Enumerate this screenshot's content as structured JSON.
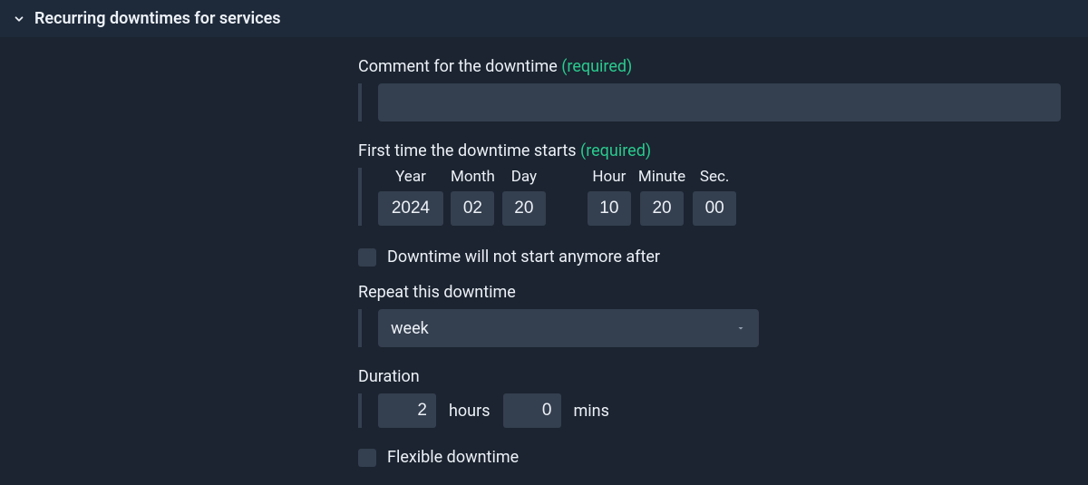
{
  "header": {
    "title": "Recurring downtimes for services"
  },
  "comment": {
    "label": "Comment for the downtime",
    "required": "(required)"
  },
  "starttime": {
    "label": "First time the downtime starts",
    "required": "(required)",
    "heads": {
      "year": "Year",
      "month": "Month",
      "day": "Day",
      "hour": "Hour",
      "minute": "Minute",
      "sec": "Sec."
    },
    "values": {
      "year": "2024",
      "month": "02",
      "day": "20",
      "hour": "10",
      "minute": "20",
      "sec": "00"
    }
  },
  "endtime": {
    "checkbox_label": "Downtime will not start anymore after"
  },
  "repeat": {
    "label": "Repeat this downtime",
    "value": "week"
  },
  "duration": {
    "label": "Duration",
    "hours_value": "2",
    "hours_unit": "hours",
    "mins_value": "0",
    "mins_unit": "mins"
  },
  "flexible": {
    "checkbox_label": "Flexible downtime"
  }
}
